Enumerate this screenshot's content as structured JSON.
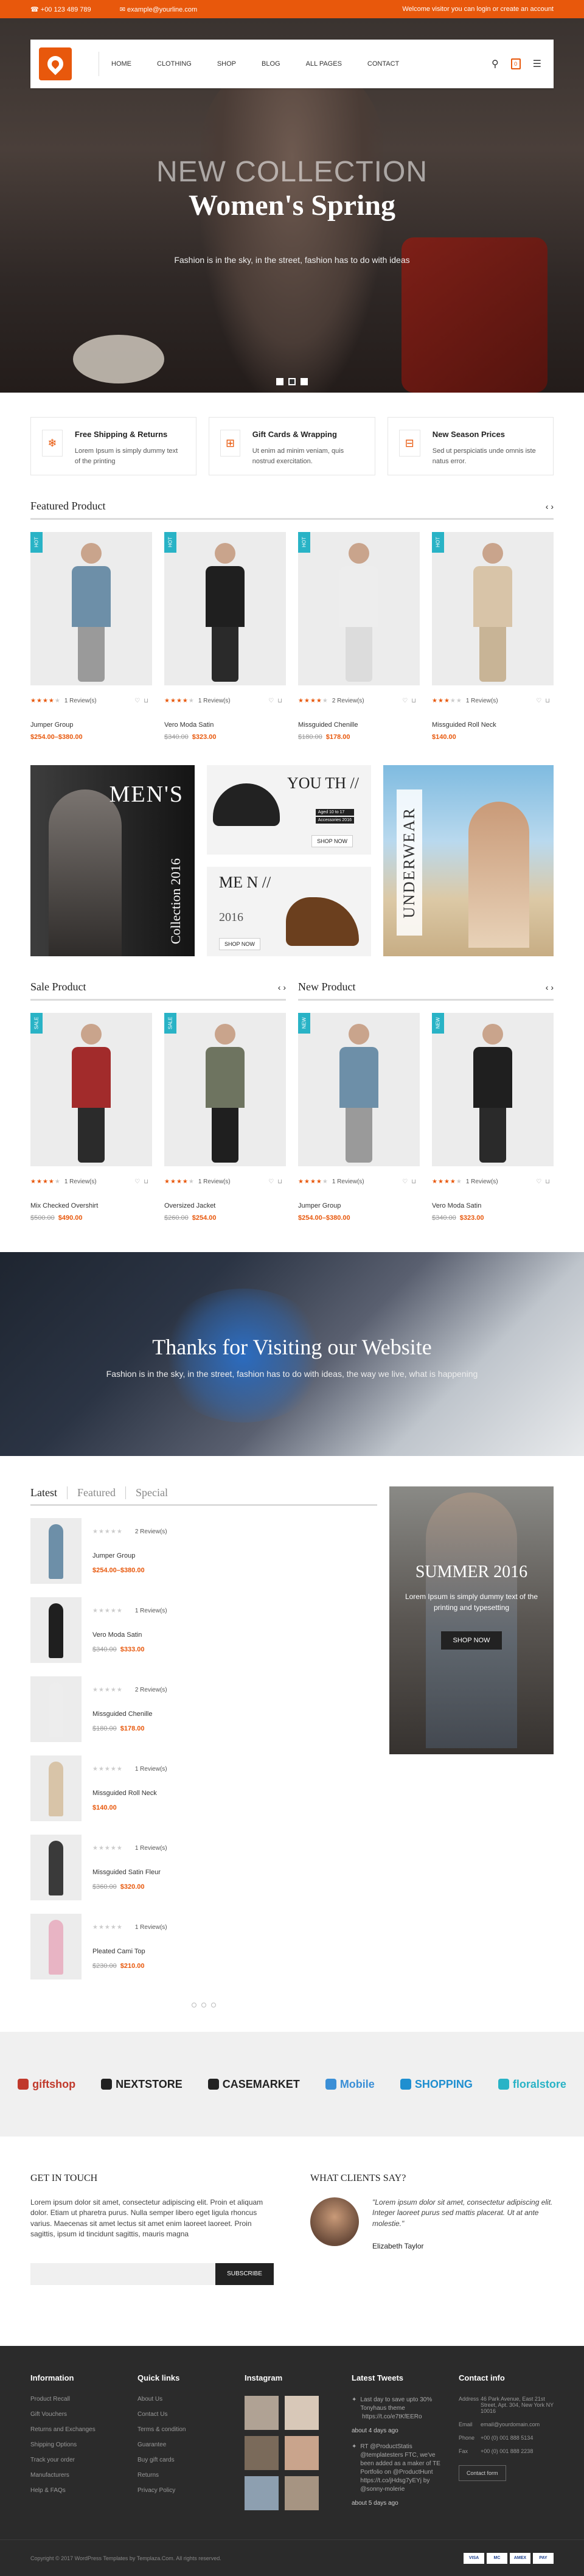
{
  "topbar": {
    "phone": "+00 123 489 789",
    "email": "example@yourline.com",
    "welcome": "Welcome visitor you can login or create an account"
  },
  "nav": {
    "links": [
      "HOME",
      "CLOTHING",
      "SHOP",
      "BLOG",
      "ALL PAGES",
      "CONTACT"
    ],
    "cart_count": "0"
  },
  "hero": {
    "line1": "NEW COLLECTION",
    "line2": "Women's Spring",
    "line3": "Fashion is in the sky, in the street, fashion has to do with ideas"
  },
  "features": [
    {
      "icon": "snowflake-icon",
      "title": "Free Shipping & Returns",
      "text": "Lorem Ipsum is simply dummy text of the printing"
    },
    {
      "icon": "gift-icon",
      "title": "Gift Cards & Wrapping",
      "text": "Ut enim ad minim veniam, quis nostrud exercitation."
    },
    {
      "icon": "tag-icon",
      "title": "New Season Prices",
      "text": "Sed ut perspiciatis unde omnis iste natus error."
    }
  ],
  "featured": {
    "title": "Featured Product",
    "products": [
      {
        "badge": "HOT",
        "name": "Jumper Group",
        "rating": 4,
        "reviews": "1 Review(s)",
        "old": "",
        "price": "$254.00–$380.00",
        "body": "#6d8fa8",
        "legs": "#9a9a9a"
      },
      {
        "badge": "HOT",
        "name": "Vero Moda Satin",
        "rating": 4,
        "reviews": "1 Review(s)",
        "old": "$340.00",
        "price": "$323.00",
        "body": "#1f1f1f",
        "legs": "#2a2a2a"
      },
      {
        "badge": "HOT",
        "name": "Missguided Chenille",
        "rating": 4,
        "reviews": "2 Review(s)",
        "old": "$180.00",
        "price": "$178.00",
        "body": "#ededed",
        "legs": "#dcdcdc"
      },
      {
        "badge": "HOT",
        "name": "Missguided Roll Neck",
        "rating": 3,
        "reviews": "1 Review(s)",
        "old": "",
        "price": "$140.00",
        "body": "#d8c4a8",
        "legs": "#c8b496"
      }
    ]
  },
  "banners": {
    "men_title": "MEN'S",
    "men_collection": "Collection 2016",
    "youth_title": "YOU TH //",
    "youth_tags": [
      "Aged 10 to 17",
      "Accessories 2016"
    ],
    "shop_now": "SHOP NOW",
    "men2_title": "ME N //",
    "men2_year": "2016",
    "underwear": "UNDERWEAR"
  },
  "sale": {
    "title": "Sale Product",
    "products": [
      {
        "badge": "SALE",
        "name": "Mix Checked Overshirt",
        "rating": 4,
        "reviews": "1 Review(s)",
        "old": "$500.00",
        "price": "$490.00",
        "body": "#a22b2b",
        "legs": "#2b2b2b"
      },
      {
        "badge": "SALE",
        "name": "Oversized Jacket",
        "rating": 4,
        "reviews": "1 Review(s)",
        "old": "$260.00",
        "price": "$254.00",
        "body": "#6e7460",
        "legs": "#1f1f1f"
      }
    ]
  },
  "newp": {
    "title": "New Product",
    "products": [
      {
        "badge": "NEW",
        "name": "Jumper Group",
        "rating": 4,
        "reviews": "1 Review(s)",
        "old": "",
        "price": "$254.00–$380.00",
        "body": "#6d8fa8",
        "legs": "#9a9a9a"
      },
      {
        "badge": "NEW",
        "name": "Vero Moda Satin",
        "rating": 4,
        "reviews": "1 Review(s)",
        "old": "$340.00",
        "price": "$323.00",
        "body": "#1f1f1f",
        "legs": "#2a2a2a"
      }
    ]
  },
  "thanks": {
    "title": "Thanks for Visiting our Website",
    "text": "Fashion is in the sky, in the street, fashion has to do with ideas, the way we live, what is happening"
  },
  "tabs": {
    "labels": [
      "Latest",
      "Featured",
      "Special"
    ],
    "items": [
      {
        "name": "Jumper Group",
        "reviews": "2 Review(s)",
        "old": "",
        "price": "$254.00–$380.00",
        "color": "#6d8fa8"
      },
      {
        "name": "Vero Moda Satin",
        "reviews": "1 Review(s)",
        "old": "$340.00",
        "price": "$333.00",
        "color": "#1f1f1f"
      },
      {
        "name": "Missguided Chenille",
        "reviews": "2 Review(s)",
        "old": "$180.00",
        "price": "$178.00",
        "color": "#ededed"
      },
      {
        "name": "Missguided Roll Neck",
        "reviews": "1 Review(s)",
        "old": "",
        "price": "$140.00",
        "color": "#d8c4a8"
      },
      {
        "name": "Missguided Satin Fleur",
        "reviews": "1 Review(s)",
        "old": "$360.00",
        "price": "$320.00",
        "color": "#3a3a3a"
      },
      {
        "name": "Pleated Cami Top",
        "reviews": "1 Review(s)",
        "old": "$230.00",
        "price": "$210.00",
        "color": "#e8b4c4"
      }
    ],
    "summer_title": "SUMMER 2016",
    "summer_text": "Lorem Ipsum is simply dummy text of the printing and typesetting",
    "summer_btn": "SHOP NOW"
  },
  "brands": [
    {
      "name": "giftshop",
      "icon": "gift-icon",
      "color": "#c0392b"
    },
    {
      "name": "NEXTSTORE",
      "icon": "arrow-icon",
      "color": "#222"
    },
    {
      "name": "CASEMARKET",
      "icon": "case-icon",
      "color": "#222"
    },
    {
      "name": "Mobile",
      "icon": "phone-icon",
      "color": "#3b8fd6"
    },
    {
      "name": "SHOPPING",
      "icon": "bag-icon",
      "color": "#1f8fd0"
    },
    {
      "name": "floralstore",
      "icon": "flower-icon",
      "color": "#29b3c6"
    }
  ],
  "contact": {
    "title": "GET IN TOUCH",
    "text": "Lorem ipsum dolor sit amet, consectetur adipiscing elit. Proin et aliquam dolor. Etiam ut pharetra purus. Nulla semper libero eget ligula rhoncus varius. Maecenas sit amet lectus sit amet enim laoreet laoreet. Proin sagittis, ipsum id tincidunt sagittis, mauris magna",
    "subscribe": "SUBSCRIBE",
    "clients_title": "WHAT CLIENTS SAY?",
    "quote": "\"Lorem ipsum dolor sit amet, consectetur adipiscing elit. Integer laoreet purus sed mattis placerat. Ut at ante molestie.\"",
    "author": "Elizabeth Taylor"
  },
  "footer": {
    "info_title": "Information",
    "info": [
      "Product Recall",
      "Gift Vouchers",
      "Returns and Exchanges",
      "Shipping Options",
      "Track your order",
      "Manufacturers",
      "Help & FAQs"
    ],
    "quick_title": "Quick links",
    "quick": [
      "About Us",
      "Contact Us",
      "Terms & condition",
      "Guarantee",
      "Buy gift cards",
      "Returns",
      "Privacy Policy"
    ],
    "insta_title": "Instagram",
    "insta_colors": [
      "#b0a294",
      "#d8c8b8",
      "#7a6a5a",
      "#c9a48c",
      "#8d9fb0",
      "#a69482"
    ],
    "tweets_title": "Latest Tweets",
    "tweets": [
      {
        "text": "Last day to save upto 30% Tonyhaus theme  https://t.co/e7tKfEERo",
        "ago": "about 4 days ago"
      },
      {
        "text": "RT @ProductStatis @templatesters FTC, we've been added as a maker of TE Portfolio on @ProductHunt https://t.co/jHdsg7yEYj by @sonny-molerie",
        "ago": "about 5 days ago"
      }
    ],
    "contact_title": "Contact info",
    "contact": [
      {
        "k": "Address",
        "v": "46 Park Avenue, East 21st Street, Apt. 304, New York NY 10016"
      },
      {
        "k": "Email",
        "v": "email@yourdomain.com"
      },
      {
        "k": "Phone",
        "v": "+00 (0) 001 888 5134"
      },
      {
        "k": "Fax",
        "v": "+00 (0) 001 888 2238"
      }
    ],
    "contact_btn": "Contact form",
    "copyright": "Copyright © 2017 WordPress Templates by Templaza.Com. All rights reserved.",
    "cards": [
      "VISA",
      "MC",
      "AMEX",
      "PAY"
    ]
  }
}
